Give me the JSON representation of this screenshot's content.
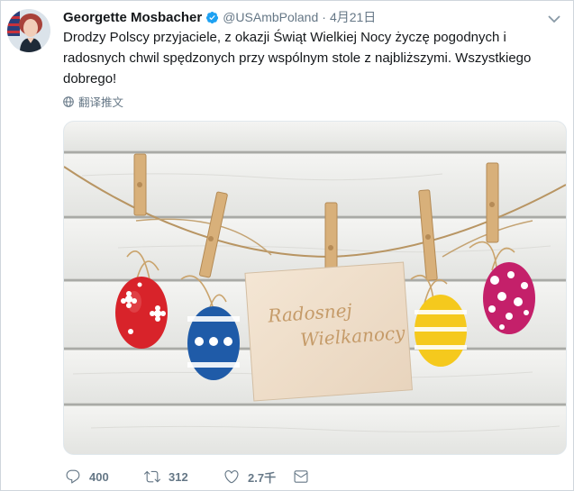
{
  "tweet": {
    "display_name": "Georgette Mosbacher",
    "verified": true,
    "handle": "@USAmbPoland",
    "separator": "·",
    "timestamp": "4月21日",
    "text": "Drodzy Polscy przyjaciele, z okazji Świąt Wielkiej Nocy życzę pogodnych i radosnych chwil spędzonych przy wspólnym stole z najbliższymi. Wszystkiego dobrego!",
    "translate_label": "翻译推文",
    "media": {
      "card_text_line1": "Radosnej",
      "card_text_line2": "Wielkanocy"
    },
    "actions": {
      "reply_count": "400",
      "retweet_count": "312",
      "like_count": "2.7千"
    }
  },
  "icons": {
    "verified": "verified-badge-icon",
    "more": "chevron-down-icon",
    "translate": "globe-icon",
    "reply": "reply-icon",
    "retweet": "retweet-icon",
    "like": "heart-icon",
    "message": "envelope-icon"
  },
  "colors": {
    "text": "#14171a",
    "secondary": "#657786",
    "verified": "#1da1f2",
    "border": "#cfd6dc"
  }
}
